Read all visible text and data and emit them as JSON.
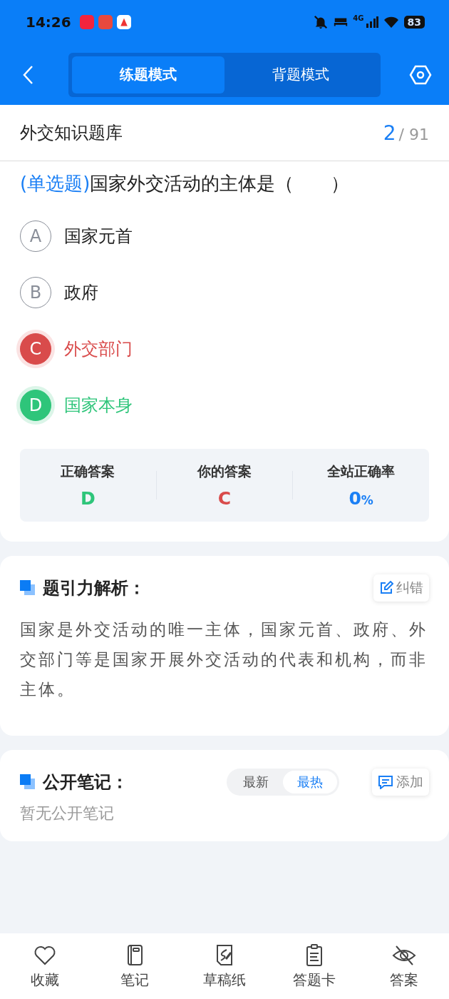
{
  "status_bar": {
    "time": "14:26",
    "network": "4G",
    "battery": "83"
  },
  "header": {
    "modes": [
      {
        "label": "练题模式",
        "selected": true
      },
      {
        "label": "背题模式",
        "selected": false
      }
    ]
  },
  "title_bar": {
    "title": "外交知识题库",
    "current": "2",
    "total": "/ 91"
  },
  "question": {
    "type": "(单选题)",
    "text": "国家外交活动的主体是（　　）",
    "options": [
      {
        "letter": "A",
        "text": "国家元首",
        "kind": "plain"
      },
      {
        "letter": "B",
        "text": "政府",
        "kind": "plain"
      },
      {
        "letter": "C",
        "text": "外交部门",
        "kind": "wrong"
      },
      {
        "letter": "D",
        "text": "国家本身",
        "kind": "correct"
      }
    ],
    "stats": [
      {
        "label": "正确答案",
        "value": "D",
        "kind": "correct"
      },
      {
        "label": "你的答案",
        "value": "C",
        "kind": "wrong"
      },
      {
        "label": "全站正确率",
        "value": "0",
        "unit": "%",
        "kind": "rate"
      }
    ]
  },
  "analysis": {
    "title": "题引力解析：",
    "action": "纠错",
    "text": "国家是外交活动的唯一主体，国家元首、政府、外交部门等是国家开展外交活动的代表和机构，而非主体。"
  },
  "notes": {
    "title": "公开笔记：",
    "sort_tabs": [
      {
        "label": "最新",
        "selected": false
      },
      {
        "label": "最热",
        "selected": true
      }
    ],
    "action": "添加",
    "empty": "暂无公开笔记"
  },
  "bottom_nav": [
    {
      "label": "收藏"
    },
    {
      "label": "笔记"
    },
    {
      "label": "草稿纸"
    },
    {
      "label": "答题卡"
    },
    {
      "label": "答案"
    }
  ]
}
